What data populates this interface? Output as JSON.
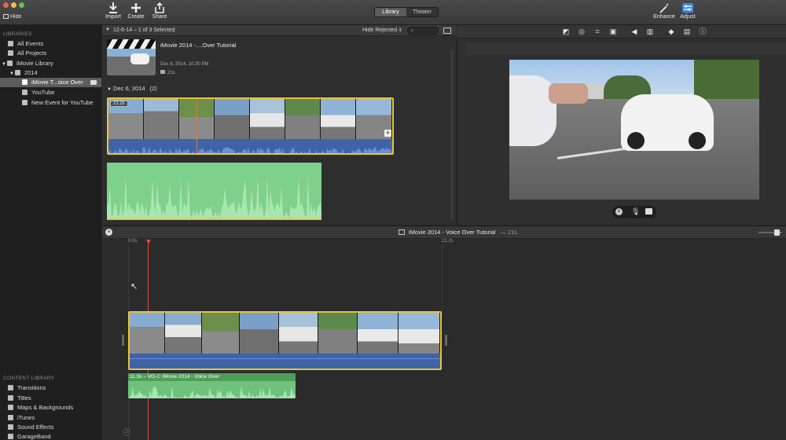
{
  "toolbar": {
    "hide_label": "Hide",
    "import_label": "Import",
    "create_label": "Create",
    "share_label": "Share",
    "library_tab": "Library",
    "theater_tab": "Theater",
    "enhance_label": "Enhance",
    "adjust_label": "Adjust"
  },
  "sidebar": {
    "libraries_heading": "LIBRARIES",
    "all_events": "All Events",
    "all_projects": "All Projects",
    "imovie_library": "iMovie Library",
    "year_2014": "2014",
    "imovie_project": "iMovie T...oice Over",
    "youtube": "YouTube",
    "new_event": "New Event for YouTube",
    "content_heading": "CONTENT LIBRARY",
    "content_items": [
      "Transitions",
      "Titles",
      "Maps & Backgrounds",
      "iTunes",
      "Sound Effects",
      "GarageBand"
    ]
  },
  "browser": {
    "selection_info": "12-6-14 – 1 of 3 Selected",
    "filter_label": "Hide Rejected",
    "project_title": "iMovie 2014 -....Over Tutorial",
    "project_date": "Dec 6, 2014, 10:30 PM",
    "project_duration": "21s",
    "event_date": "Dec 6, 2014",
    "event_count": "(2)",
    "clip_duration": "21.2s"
  },
  "timeline": {
    "project_name": "iMovie 2014 - Voice Over Tutorial",
    "project_length": "21s",
    "ruler_start": "0.0s",
    "ruler_end": "21.2s",
    "voiceover_label": "11.3s – VO-1: iMovie 2014 - Voice Over"
  },
  "colors": {
    "accent_yellow": "#e8c43a",
    "audio_green": "#7fd08b",
    "audio_blue": "#3f63a8",
    "playhead": "#e74c3c"
  }
}
